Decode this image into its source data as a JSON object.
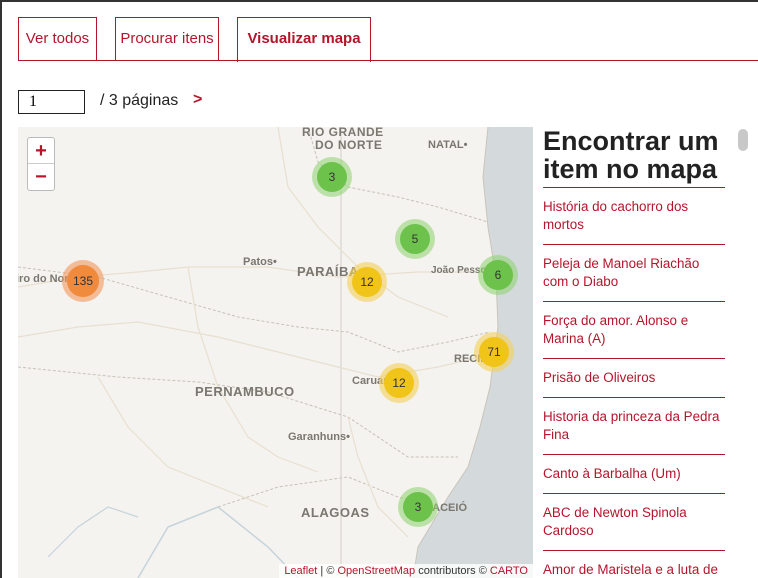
{
  "tabs": [
    {
      "label": "Ver todos"
    },
    {
      "label": "Procurar itens"
    },
    {
      "label": "Visualizar mapa"
    }
  ],
  "pager": {
    "current_value": "1",
    "total_text": "/ 3 páginas",
    "next_label": ">"
  },
  "map": {
    "zoom_in": "+",
    "zoom_out": "−",
    "labels": [
      "RIO GRANDE",
      "DO NORTE",
      "NATAL•",
      "Patos•",
      "PARAÍBA",
      "João Pessoa",
      "iro do Nor",
      "RECIFE",
      "Caruaru",
      "PERNAMBUCO",
      "Garanhuns•",
      "ALAGOAS",
      "MACEIÓ"
    ],
    "clusters": [
      {
        "count": "3",
        "color": "green"
      },
      {
        "count": "5",
        "color": "green"
      },
      {
        "count": "6",
        "color": "green"
      },
      {
        "count": "135",
        "color": "orange"
      },
      {
        "count": "12",
        "color": "yellow"
      },
      {
        "count": "71",
        "color": "yellow"
      },
      {
        "count": "12",
        "color": "yellow"
      },
      {
        "count": "3",
        "color": "green"
      }
    ],
    "attribution": {
      "leaflet": "Leaflet",
      "sep1": " | © ",
      "osm": "OpenStreetMap",
      "mid": " contributors © ",
      "carto": "CARTO"
    }
  },
  "side": {
    "title": "Encontrar um item no mapa",
    "items": [
      "História do cachorro dos mortos",
      "Peleja de Manoel Riachão com o Diabo",
      "Força do amor. Alonso e Marina (A)",
      "Prisão de Oliveiros",
      "Historia da princeza da Pedra Fina",
      "Canto à Barbalha (Um)",
      "ABC de Newton Spinola Cardoso",
      "Amor de Maristela e a luta de"
    ]
  },
  "colors": {
    "accent": "#b5152b",
    "cluster_green": "#6cc24a",
    "cluster_yellow": "#f0c419",
    "cluster_orange": "#f08a3c"
  }
}
